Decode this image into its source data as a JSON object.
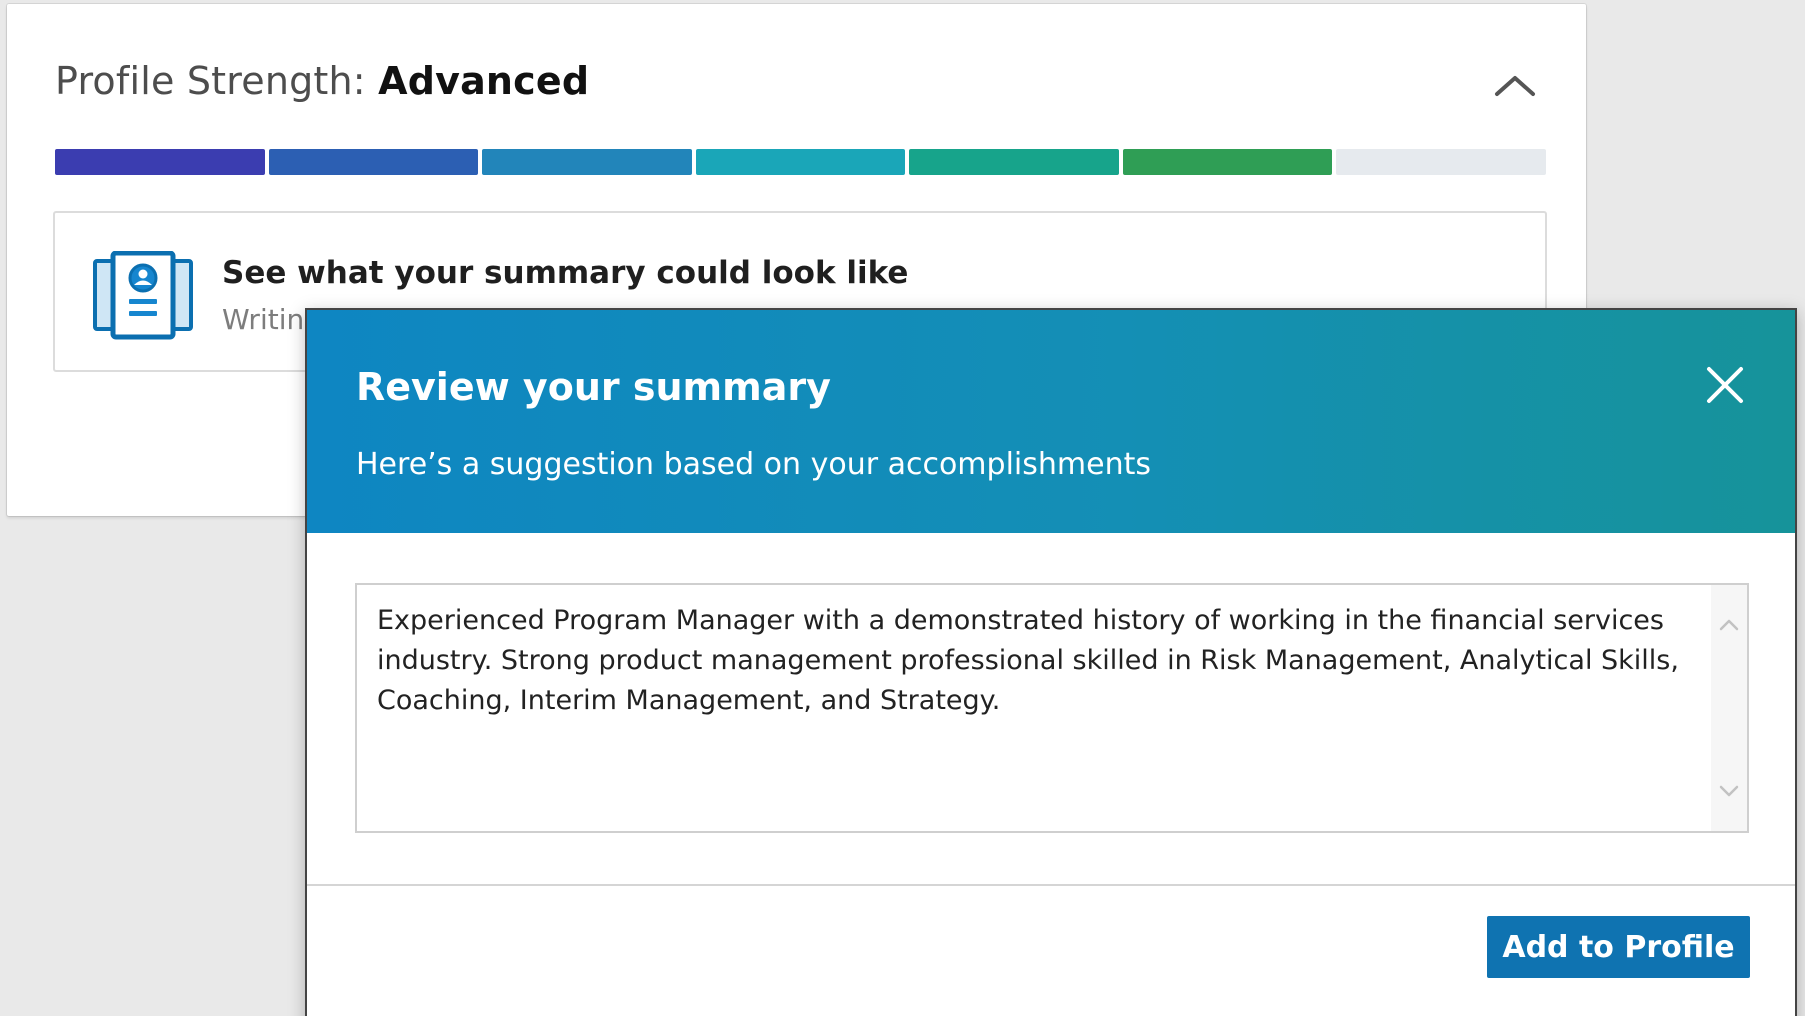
{
  "profile_strength": {
    "label": "Profile Strength: ",
    "level": "Advanced",
    "collapse_icon": "chevron-up-icon",
    "meter": {
      "total_segments": 7,
      "filled_segments": 6,
      "segment_colors": [
        "#3b3db0",
        "#2c5fb3",
        "#2285ba",
        "#1aa6b8",
        "#17a48b",
        "#2f9e55",
        "#e6eaee"
      ]
    }
  },
  "suggestion_card": {
    "icon": "profile-document-icon",
    "title": "See what your summary could look like",
    "description": "Writing"
  },
  "modal": {
    "title": "Review your summary",
    "subtitle": "Here’s a suggestion based on your accomplishments",
    "close_icon": "close-icon",
    "summary_text": "Experienced Program Manager with a demonstrated history of working in the financial services industry. Strong product management professional skilled in Risk Management, Analytical Skills, Coaching, Interim Management, and Strategy.",
    "add_button_label": "Add to Profile"
  },
  "colors": {
    "header_gradient_start": "#0e86c2",
    "header_gradient_end": "#16939a",
    "primary_button": "#0f73b1",
    "icon_blue": "#0b6fb0"
  }
}
